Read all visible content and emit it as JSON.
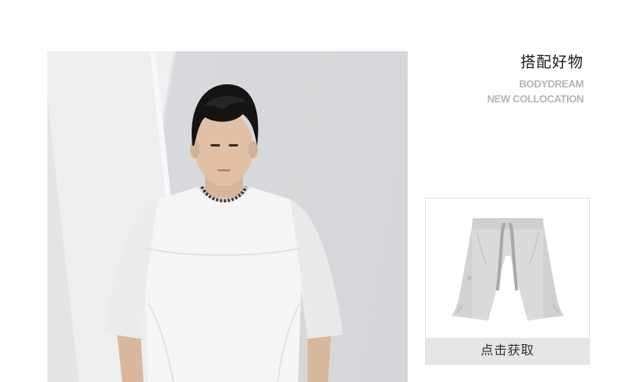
{
  "section": {
    "title_zh": "搭配好物",
    "title_en_line1": "BODYDREAM",
    "title_en_line2": "NEW COLLOCATION"
  },
  "hero": {
    "image": "model-in-white-tee"
  },
  "product": {
    "image": "grey-drawstring-shorts",
    "cta_label": "点击获取"
  }
}
